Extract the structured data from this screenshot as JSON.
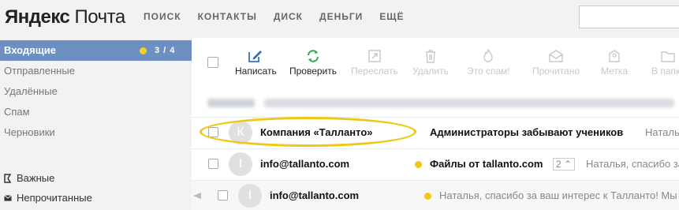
{
  "header": {
    "logo_bold": "Яндекс",
    "logo_rest": "Почта",
    "nav": [
      "поиск",
      "контакты",
      "диск",
      "деньги",
      "ещё"
    ],
    "search_placeholder": ""
  },
  "sidebar": {
    "folders": [
      {
        "label": "Входящие",
        "count": "3 / 4",
        "active": true
      },
      {
        "label": "Отправленные"
      },
      {
        "label": "Удалённые"
      },
      {
        "label": "Спам"
      },
      {
        "label": "Черновики"
      }
    ],
    "labels": [
      {
        "label": "Важные",
        "icon": "important-flag-icon"
      },
      {
        "label": "Непрочитанные",
        "icon": "unread-envelope-icon"
      }
    ]
  },
  "toolbar": {
    "buttons": [
      {
        "label": "Написать",
        "icon": "compose-icon",
        "enabled": true
      },
      {
        "label": "Проверить",
        "icon": "refresh-icon",
        "enabled": true
      },
      {
        "label": "Переслать",
        "icon": "forward-icon",
        "enabled": false
      },
      {
        "label": "Удалить",
        "icon": "trash-icon",
        "enabled": false
      },
      {
        "label": "Это спам!",
        "icon": "spam-fire-icon",
        "enabled": false
      },
      {
        "label": "Прочитано",
        "icon": "read-envelope-icon",
        "enabled": false
      },
      {
        "label": "Метка",
        "icon": "label-tag-icon",
        "enabled": false
      },
      {
        "label": "В папку",
        "icon": "folder-icon",
        "enabled": false
      }
    ]
  },
  "messages": [
    {
      "avatar": "К",
      "from": "Компания «Талланто»",
      "subject": "Администраторы забывают учеников",
      "snippet": "Наталья!"
    },
    {
      "avatar": "I",
      "from": "info@tallanto.com",
      "subject": "Файлы от tallanto.com",
      "thread_count": "2",
      "snippet": "Наталья, спасибо за"
    },
    {
      "avatar": "I",
      "from": "info@tallanto.com",
      "snippet": "Наталья, спасибо за ваш интерес к Талланто! Мы"
    }
  ],
  "colors": {
    "accent": "#6e8fc2",
    "unread_dot": "#f5c518",
    "highlight": "#f0c712",
    "refresh_green": "#2fa84f",
    "compose_blue": "#3d6fb7"
  }
}
